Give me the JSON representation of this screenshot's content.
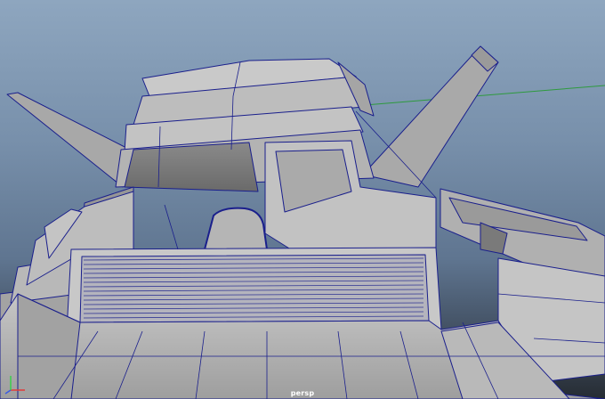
{
  "viewport": {
    "camera_name": "persp",
    "wire_color": "#1a1f8c",
    "grid_color": "#2e9a3e",
    "shade_color": "#b9b9b9"
  },
  "axis_gizmo": {
    "x_color": "#e23a3a",
    "y_color": "#3ad04a",
    "z_color": "#3a5ae2"
  }
}
